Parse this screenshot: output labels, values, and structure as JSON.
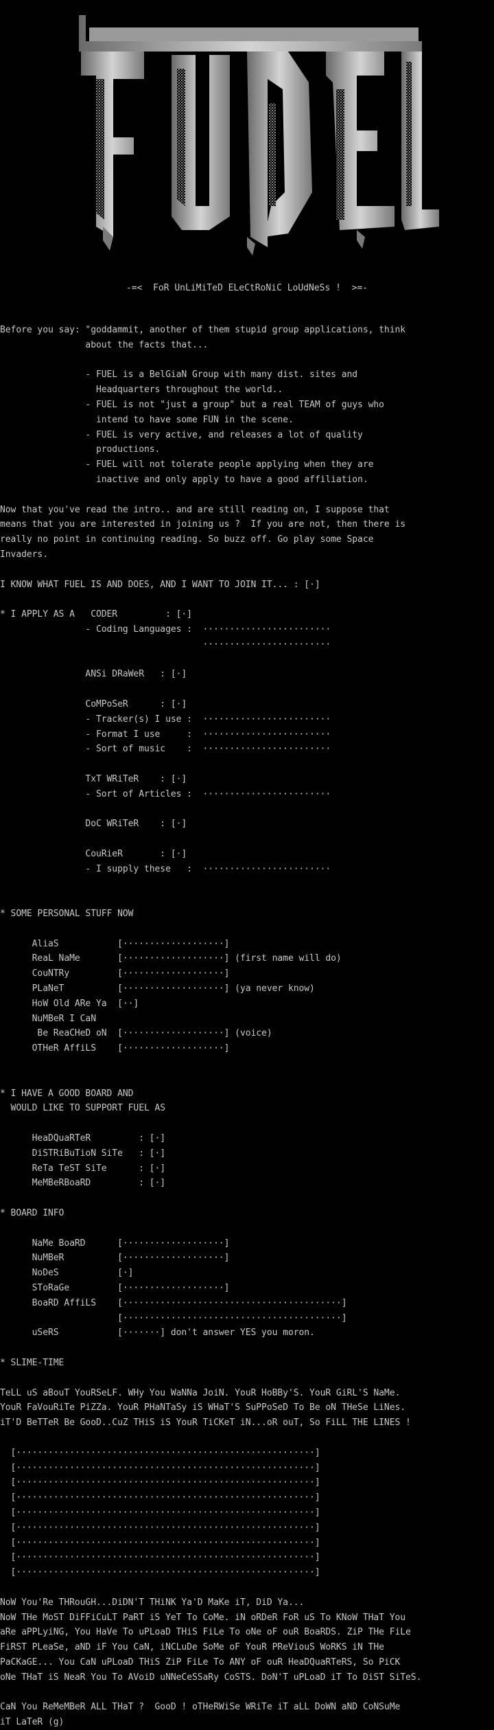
{
  "logo": {
    "text": "FUEL"
  },
  "tagline": "-=<  FoR UnLiMiTeD ELeCtRoNiC LoUdNeSs !  >=-",
  "lines": [
    "Before you say: \"goddammit, another of them stupid group applications, think",
    "                about the facts that...",
    "",
    "                - FUEL is a BelGiaN Group with many dist. sites and",
    "                  Headquarters throughout the world..",
    "                - FUEL is not \"just a group\" but a real TEAM of guys who",
    "                  intend to have some FUN in the scene.",
    "                - FUEL is very active, and releases a lot of quality",
    "                  productions.",
    "                - FUEL will not tolerate people applying when they are",
    "                  inactive and only apply to have a good affiliation.",
    "",
    "Now that you've read the intro.. and are still reading on, I suppose that",
    "means that you are interested in joining us ?  If you are not, then there is",
    "really no point in continuing reading. So buzz off. Go play some Space",
    "Invaders.",
    "",
    "I KNOW WHAT FUEL IS AND DOES, AND I WANT TO JOIN IT... : [·]",
    "",
    "* I APPLY AS A   CODER         : [·]",
    "                - Coding Languages :  ························",
    "                                      ························",
    "",
    "                ANSi DRaWeR   : [·]",
    "",
    "                CoMPoSeR      : [·]",
    "                - Tracker(s) I use :  ························",
    "                - Format I use     :  ························",
    "                - Sort of music    :  ························",
    "",
    "                TxT WRiTeR    : [·]",
    "                - Sort of Articles :  ························",
    "",
    "                DoC WRiTeR    : [·]",
    "",
    "                CouRieR       : [·]",
    "                - I supply these   :  ························",
    "",
    "",
    "* SOME PERSONAL STUFF NOW",
    "",
    "      AliaS           [···················]",
    "      ReaL NaMe       [···················] (first name will do)",
    "      CouNTRy         [···················]",
    "      PLaNeT          [···················] (ya never know)",
    "      HoW Old ARe Ya  [··]",
    "      NuMBeR I CaN",
    "       Be ReaCHeD oN  [···················] (voice)",
    "      OTHeR AffiLS    [···················]",
    "",
    "",
    "* I HAVE A GOOD BOARD AND",
    "  WOULD LIKE TO SUPPORT FUEL AS",
    "",
    "      HeaDQuaRTeR         : [·]",
    "      DiSTRiBuTioN SiTe   : [·]",
    "      ReTa TeST SiTe      : [·]",
    "      MeMBeRBoaRD         : [·]",
    "",
    "* BOARD INFO",
    "",
    "      NaMe BoaRD      [···················]",
    "      NuMBeR          [···················]",
    "      NoDeS           [·]",
    "      SToRaGe         [···················]",
    "      BoaRD AffiLS    [·········································]",
    "                      [·········································]",
    "      uSeRS           [·······] don't answer YES you moron.",
    "",
    "* SLIME-TIME",
    "",
    "TeLL uS aBouT YouRSeLF. WHy You WaNNa JoiN. YouR HoBBy'S. YouR GiRL'S NaMe.",
    "YouR FaVouRiTe PiZZa. YouR PHaNTaSy iS WHaT'S SuPPoSeD To Be oN THeSe LiNes.",
    "iT'D BeTTeR Be GooD..CuZ THiS iS YouR TiCKeT iN...oR ouT, So FiLL THE LINES !",
    "",
    "  [························································]",
    "  [························································]",
    "  [························································]",
    "  [························································]",
    "  [························································]",
    "  [························································]",
    "  [························································]",
    "  [························································]",
    "  [························································]",
    "",
    "NoW You'Re THRouGH...DiDN'T THiNK Ya'D MaKe iT, DiD Ya...",
    "NoW THe MoST DiFFiCuLT PaRT iS YeT To CoMe. iN oRDeR FoR uS To KNoW THaT You",
    "aRe aPPLyiNG, You HaVe To uPLoaD THiS FiLe To oNe oF ouR BoaRDS. ZiP THe FiLe",
    "FiRST PLeaSe, aND iF You CaN, iNCLuDe SoMe oF YouR PReViouS WoRKS iN THe",
    "PaCKaGE... You CaN uPLoaD THiS ZiP FiLe To ANY oF ouR HeaDQuaRTeRS, So PiCK",
    "oNe THaT iS NeaR You To AVoiD uNNeCeSSaRy CoSTS. DoN'T uPLoaD iT To DiST SiTeS.",
    "",
    "CaN You ReMeMBeR ALL THaT ?  GooD ! oTHeRWiSe WRiTe iT aLL DoWN aND CoNSuMe",
    "iT LaTeR (g)"
  ]
}
